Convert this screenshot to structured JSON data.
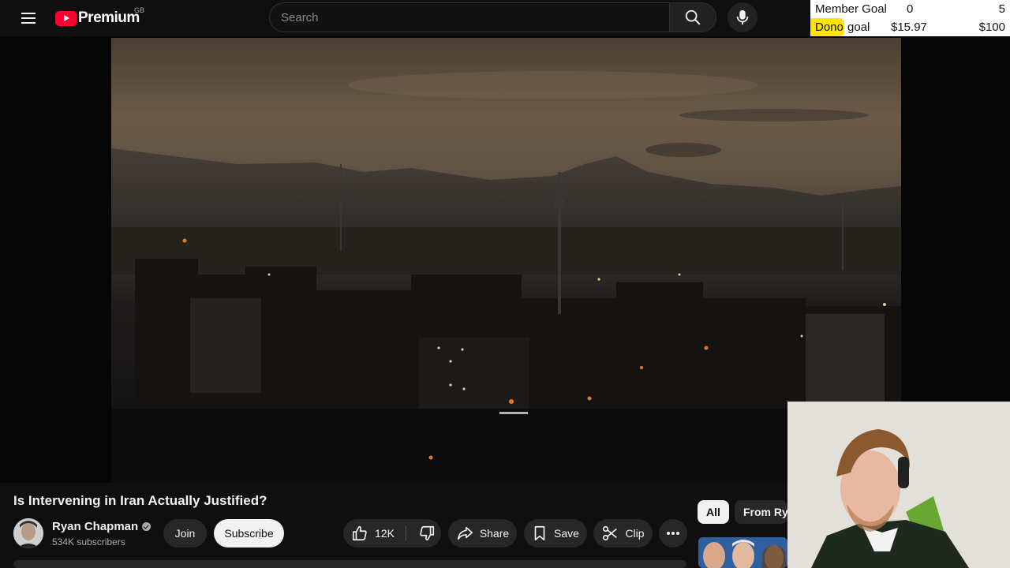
{
  "topbar": {
    "logo_text": "Premium",
    "region": "GB",
    "search_placeholder": "Search"
  },
  "goals": {
    "member": {
      "label": "Member Goal",
      "current": "0",
      "target": "5"
    },
    "dono": {
      "label_highlight": "Dono",
      "label_rest": " goal",
      "current": "$15.97",
      "target": "$100",
      "progress": 0.1597
    }
  },
  "video": {
    "title": "Is Intervening in Iran Actually Justified?",
    "channel": "Ryan Chapman",
    "subscribers": "534K subscribers",
    "join_label": "Join",
    "subscribe_label": "Subscribe",
    "likes": "12K",
    "share_label": "Share",
    "save_label": "Save",
    "clip_label": "Clip"
  },
  "related": {
    "chips": [
      "All",
      "From Rya"
    ]
  },
  "colors": {
    "brand_red": "#ff0033",
    "goal_highlight": "#ffe600",
    "background": "#0f0f0f"
  }
}
